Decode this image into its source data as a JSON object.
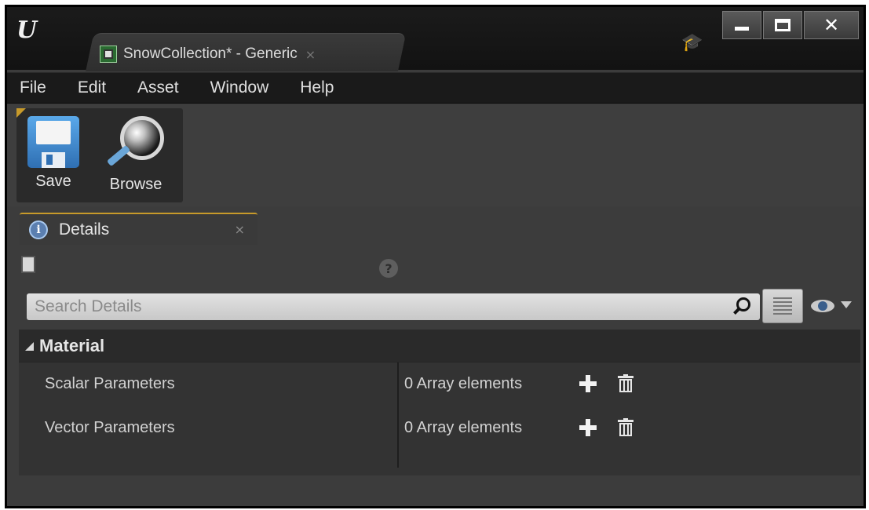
{
  "window": {
    "tab_title": "SnowCollection* - Generic",
    "tab_close": "×",
    "logo": "U",
    "min_icon": "window-minimize",
    "max_icon": "window-maximize",
    "close_glyph": "✕"
  },
  "menu": {
    "items": [
      {
        "label": "File"
      },
      {
        "label": "Edit"
      },
      {
        "label": "Asset"
      },
      {
        "label": "Window"
      },
      {
        "label": "Help"
      }
    ]
  },
  "toolbar": {
    "save_label": "Save",
    "browse_label": "Browse"
  },
  "details": {
    "tab_label": "Details",
    "tab_close": "×",
    "help_glyph": "?",
    "search_placeholder": "Search Details",
    "category": {
      "title": "Material",
      "properties": [
        {
          "name": "Scalar Parameters",
          "value": "0 Array elements"
        },
        {
          "name": "Vector Parameters",
          "value": "0 Array elements"
        }
      ]
    }
  },
  "colors": {
    "accent": "#c79a2a",
    "panel_bg": "#3c3c3c",
    "menubar_bg": "#1a1a1a"
  }
}
